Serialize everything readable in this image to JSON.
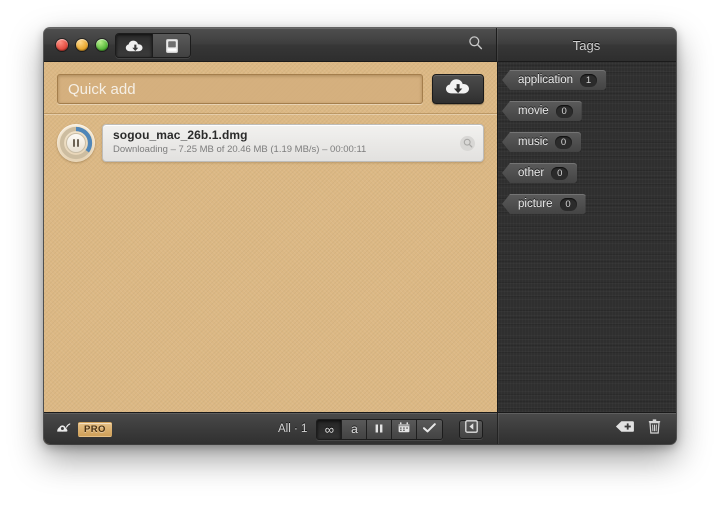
{
  "window": {
    "titlebar": {
      "traffic_lights": [
        {
          "name": "close",
          "color": "#e24b3f"
        },
        {
          "name": "minimize",
          "color": "#e8a72d"
        },
        {
          "name": "zoom",
          "color": "#57b83a"
        }
      ],
      "tabs": [
        {
          "name": "downloads-tab",
          "icon": "cloud-download-icon",
          "active": true
        },
        {
          "name": "dropbox-tab",
          "icon": "inbox-tray-icon",
          "active": false
        }
      ],
      "search_icon": "search-icon",
      "tags_panel_title": "Tags"
    }
  },
  "quick_add": {
    "placeholder": "Quick add",
    "value": "",
    "download_button_icon": "cloud-download-icon",
    "download_button_label": ""
  },
  "downloads": {
    "items": [
      {
        "name": "sogou_mac_26b.1.dmg",
        "status": "Downloading – 7.25 MB of 20.46 MB (1.19 MB/s) – 00:00:11",
        "progress_percent": 35,
        "transfer_control": "pause",
        "reveal_icon": "magnifier-icon",
        "ring_color": "#4f86b8"
      }
    ]
  },
  "tags": {
    "title": "Tags",
    "items": [
      {
        "label": "application",
        "count": "1"
      },
      {
        "label": "movie",
        "count": "0"
      },
      {
        "label": "music",
        "count": "0"
      },
      {
        "label": "other",
        "count": "0"
      },
      {
        "label": "picture",
        "count": "0"
      }
    ],
    "add_tag_icon": "tag-plus-icon",
    "delete_tag_icon": "trash-icon"
  },
  "bottom_bar": {
    "speed_limit_icon": "snail-icon",
    "pro_badge": "PRO",
    "count_label": "All · 1",
    "filters": [
      {
        "name": "filter-all",
        "glyph": "∞",
        "icon": "infinity-icon",
        "active": true
      },
      {
        "name": "filter-active",
        "glyph": "a",
        "icon": "letter-a-icon",
        "active": false
      },
      {
        "name": "filter-paused",
        "glyph": "❚❚",
        "icon": "pause-icon",
        "active": false
      },
      {
        "name": "filter-scheduled",
        "glyph": "",
        "icon": "calendar-icon",
        "active": false
      },
      {
        "name": "filter-completed",
        "glyph": "✔",
        "icon": "checkmark-icon",
        "active": false
      }
    ],
    "sidebar_toggle_icon": "hide-sidebar-icon"
  },
  "colors": {
    "main_background": "#dcb884",
    "sidebar_background": "#2f2f2f",
    "chrome": "#3c3c3c",
    "accent_pro": "#cfa059",
    "progress_ring": "#4f86b8"
  }
}
